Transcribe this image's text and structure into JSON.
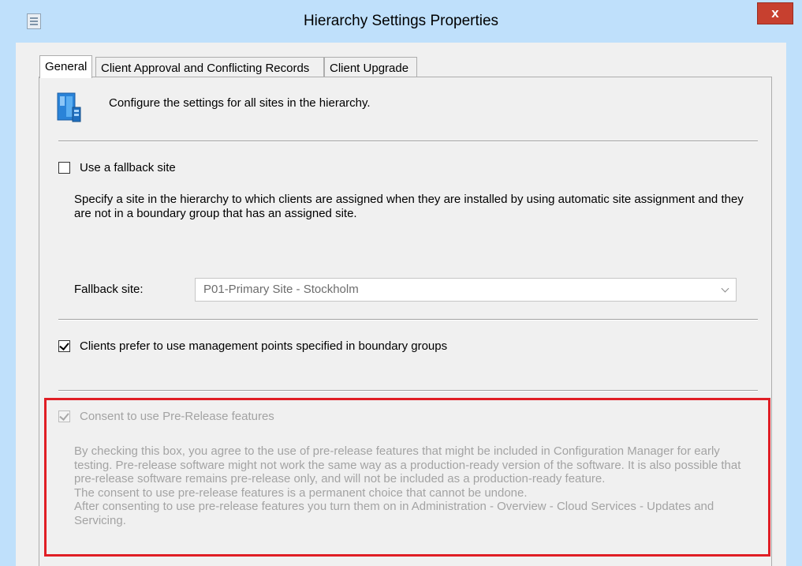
{
  "window": {
    "title": "Hierarchy Settings Properties",
    "close_label": "x"
  },
  "tabs": [
    {
      "label": "General",
      "active": true
    },
    {
      "label": "Client Approval and Conflicting Records",
      "active": false
    },
    {
      "label": "Client Upgrade",
      "active": false
    }
  ],
  "general": {
    "header_text": "Configure the settings for all sites in the hierarchy.",
    "fallback": {
      "checkbox_label": "Use a fallback site",
      "checked": false,
      "description": "Specify a site in the hierarchy to which clients are assigned when they are installed by using automatic site assignment and they are not in a boundary group that has an assigned site.",
      "site_label": "Fallback site:",
      "site_value": "P01-Primary Site - Stockholm"
    },
    "mp_prefer": {
      "checkbox_label": "Clients prefer to use management points specified in boundary groups",
      "checked": true
    },
    "prerelease": {
      "checkbox_label": "Consent to use Pre-Release features",
      "checked": true,
      "disabled": true,
      "para1": "By checking this box, you agree to the use of pre-release features that might be included in Configuration Manager for early testing. Pre-release software might not work the same way as a production-ready version of the software. It is also possible that pre-release software remains pre-release only, and will not be included as a production-ready feature.",
      "para2": "The consent to use pre-release features is a permanent choice that cannot be undone.",
      "para3": "After consenting to use pre-release features you turn them on in Administration - Overview - Cloud Services - Updates and Servicing."
    }
  },
  "colors": {
    "window_frame": "#bfe0fb",
    "close_button": "#c7402f",
    "highlight_border": "#e01e25",
    "disabled_text": "#a3a3a3"
  }
}
